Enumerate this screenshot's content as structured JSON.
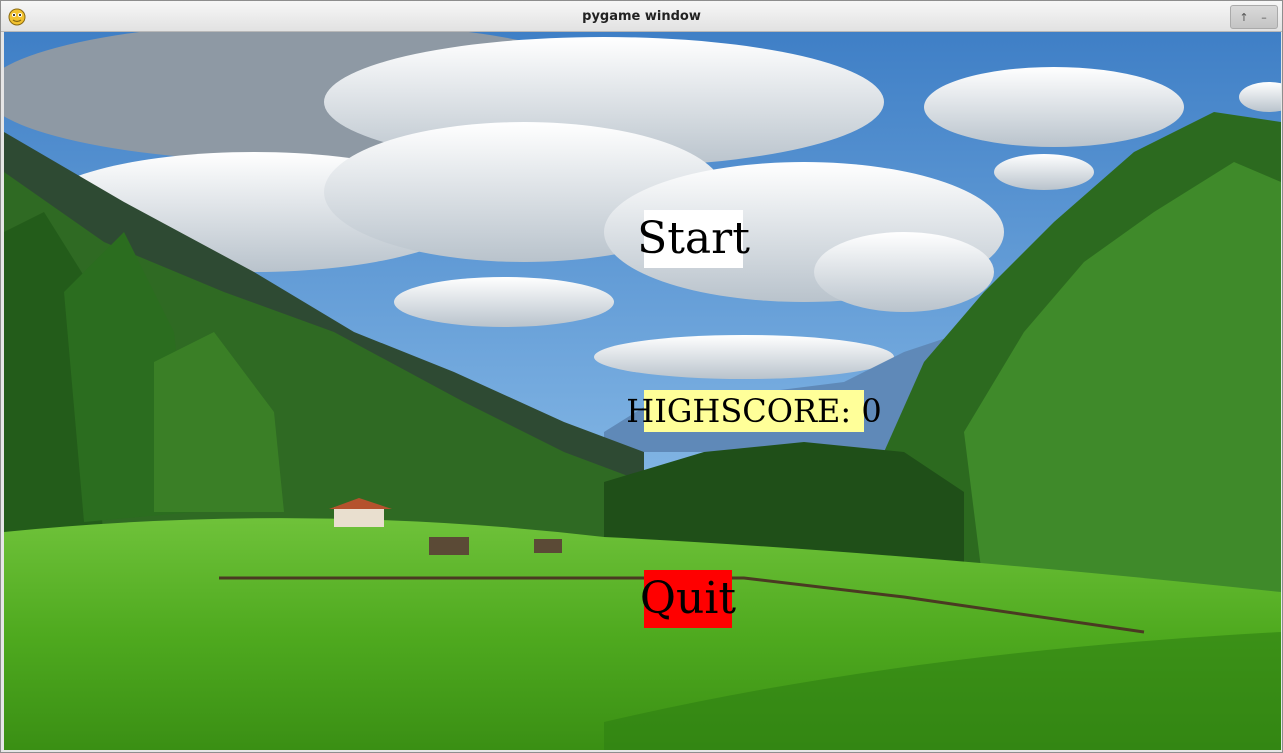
{
  "window": {
    "title": "pygame window",
    "controls": [
      "shade",
      "minimize"
    ]
  },
  "menu": {
    "start_label": "Start",
    "highscore_label": "HIGHSCORE: 0",
    "quit_label": "Quit"
  },
  "colors": {
    "start_bg": "#ffffff",
    "highscore_bg": "#ffff99",
    "quit_bg": "#ff0000"
  }
}
